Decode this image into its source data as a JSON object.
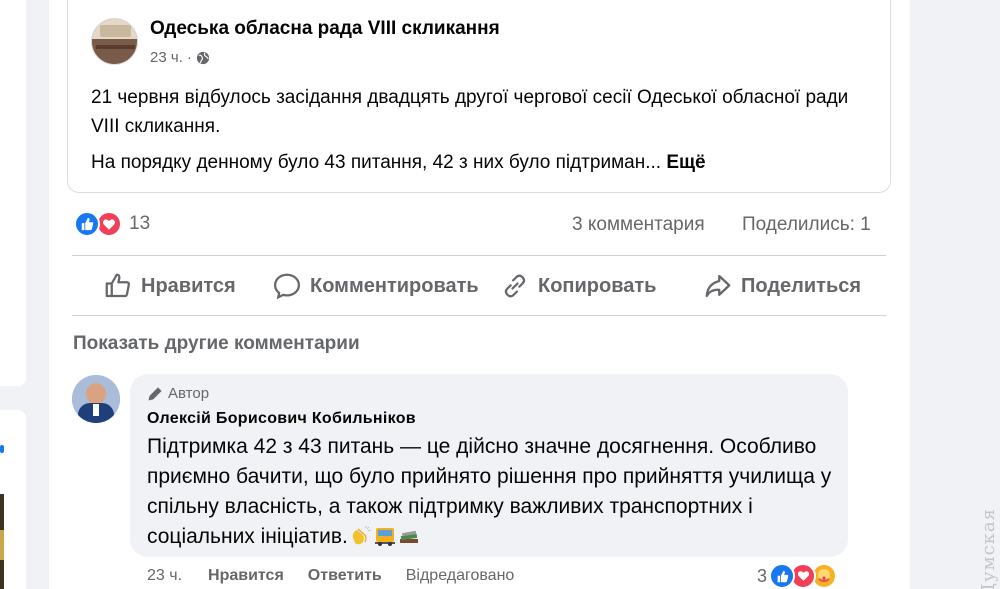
{
  "post": {
    "page_name": "Одеська обласна рада VIII скликання",
    "time": "23 ч.",
    "separator": "·",
    "text_paragraph_1": "21 червня відбулось засідання двадцять другої чергової сесії Одеської обласної ради VIII скликання.",
    "text_paragraph_2": "На порядку денному було 43 питання, 42 з них було підтриман...",
    "more_label": "Ещё"
  },
  "stats": {
    "reaction_count": "13",
    "comments": "3 комментария",
    "shares": "Поделились: 1"
  },
  "actions": {
    "like": "Нравится",
    "comment": "Комментировать",
    "copy": "Копировать",
    "share": "Поделиться"
  },
  "comments_section": {
    "show_more": "Показать другие комментарии"
  },
  "comment": {
    "badge": "Автор",
    "author": "Олексій Борисович Кобильніков",
    "text": "Підтримка 42 з 43 питань — це дійсно значне досягнення. Особливо приємно бачити, що було прийнято рішення про прийняття училища у спільну власність, а також підтримку важливих транспортних і соціальних ініціатив.",
    "time": "23 ч.",
    "like": "Нравится",
    "reply": "Ответить",
    "edited": "Відредаговано",
    "reaction_count": "3"
  },
  "watermark": "Думская",
  "icons": {
    "globe": "globe-icon",
    "like": "thumbs-up-icon",
    "comment": "speech-bubble-icon",
    "copy": "link-icon",
    "share": "share-arrow-icon",
    "pencil": "pencil-icon",
    "emojis": [
      "clapping-hands-icon",
      "bus-icon",
      "books-icon"
    ]
  },
  "colors": {
    "facebook_blue": "#1877f2",
    "love_red": "#f33e58",
    "care_yellow": "#f7b125",
    "secondary_text": "#65676b"
  }
}
